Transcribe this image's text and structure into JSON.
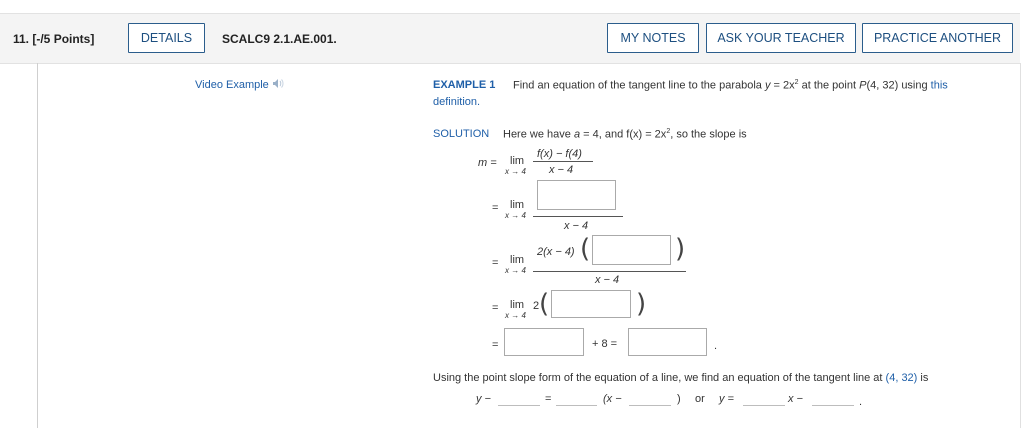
{
  "header": {
    "question": "11. [-/5 Points]",
    "details": "DETAILS",
    "code": "SCALC9 2.1.AE.001.",
    "my_notes": "MY NOTES",
    "ask_teacher": "ASK YOUR TEACHER",
    "practice": "PRACTICE ANOTHER"
  },
  "video": {
    "label": "Video Example",
    "icon": "speaker-icon"
  },
  "example": {
    "label": "EXAMPLE 1",
    "text": "Find an equation of the tangent line to the parabola",
    "eq_y": "y",
    "eq_rhs": " = 2x",
    "eq_exp": "2",
    "at_point": "at the point",
    "point_name": "P",
    "point": "(4, 32)",
    "using": "using",
    "link_this": "this",
    "link_definition": "definition."
  },
  "solution": {
    "label": "SOLUTION",
    "here": "Here we have",
    "a": "a",
    "a_eq": " = 4,",
    "and": "and",
    "fx": "f(x) = 2x",
    "fx_exp": "2",
    "slope": ", so the slope is",
    "m_eq": "m  =",
    "eq": "=",
    "lim": "lim",
    "lim_sub": "x → 4",
    "num1": "f(x) − f(4)",
    "den": "x − 4",
    "num3_pre": "2(x − 4)",
    "open_paren": "(",
    "close_paren": ")",
    "lim4_pre": "2",
    "plus8": "+ 8 =",
    "period": "."
  },
  "tangent": {
    "text": "Using the point slope form of the equation of a line, we find an equation of the tangent line at",
    "point": "(4, 32)",
    "is": "is",
    "y_minus": "y −",
    "eq": "=",
    "paren_x": "(x −",
    "close": ")",
    "or": "or",
    "y_eq": "y =",
    "x_minus": "x −",
    "period": "."
  }
}
